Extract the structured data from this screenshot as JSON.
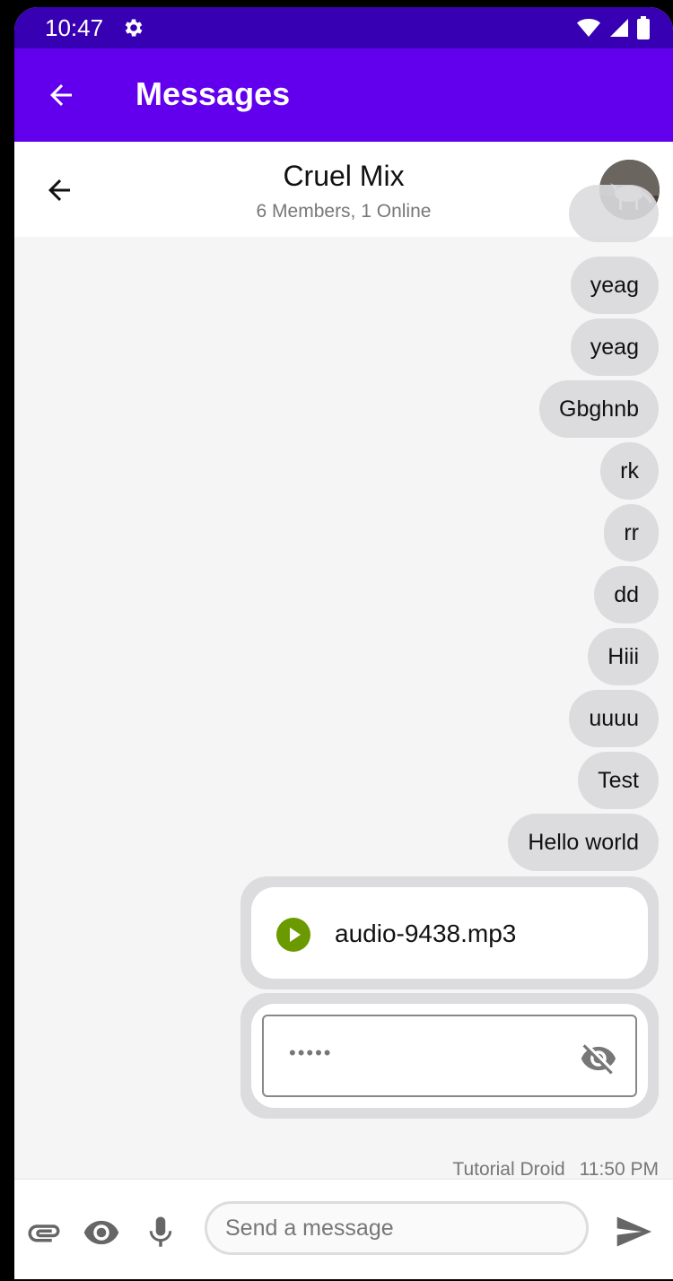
{
  "statusbar": {
    "time": "10:47",
    "gear_icon": "gear-icon",
    "wifi_icon": "wifi-icon",
    "signal_icon": "signal-icon",
    "battery_icon": "battery-icon"
  },
  "appbar": {
    "title": "Messages",
    "back_icon": "arrow-back-icon",
    "color": "#6200ee",
    "status_color": "#3700b3"
  },
  "chat": {
    "title": "Cruel Mix",
    "subtitle": "6 Members, 1 Online"
  },
  "messages": [
    {
      "text": "yeag"
    },
    {
      "text": "yeag"
    },
    {
      "text": "Gbghnb"
    },
    {
      "text": "rk"
    },
    {
      "text": "rr"
    },
    {
      "text": "dd"
    },
    {
      "text": "Hiii"
    },
    {
      "text": "uuuu"
    },
    {
      "text": "Test"
    },
    {
      "text": "Hello world"
    }
  ],
  "audio": {
    "filename": "audio-9438.mp3",
    "play_color": "#6b9a00"
  },
  "password_field": {
    "value": "•••••"
  },
  "meta": {
    "sender": "Tutorial Droid",
    "time": "11:50 PM"
  },
  "composer": {
    "placeholder": "Send a message"
  }
}
